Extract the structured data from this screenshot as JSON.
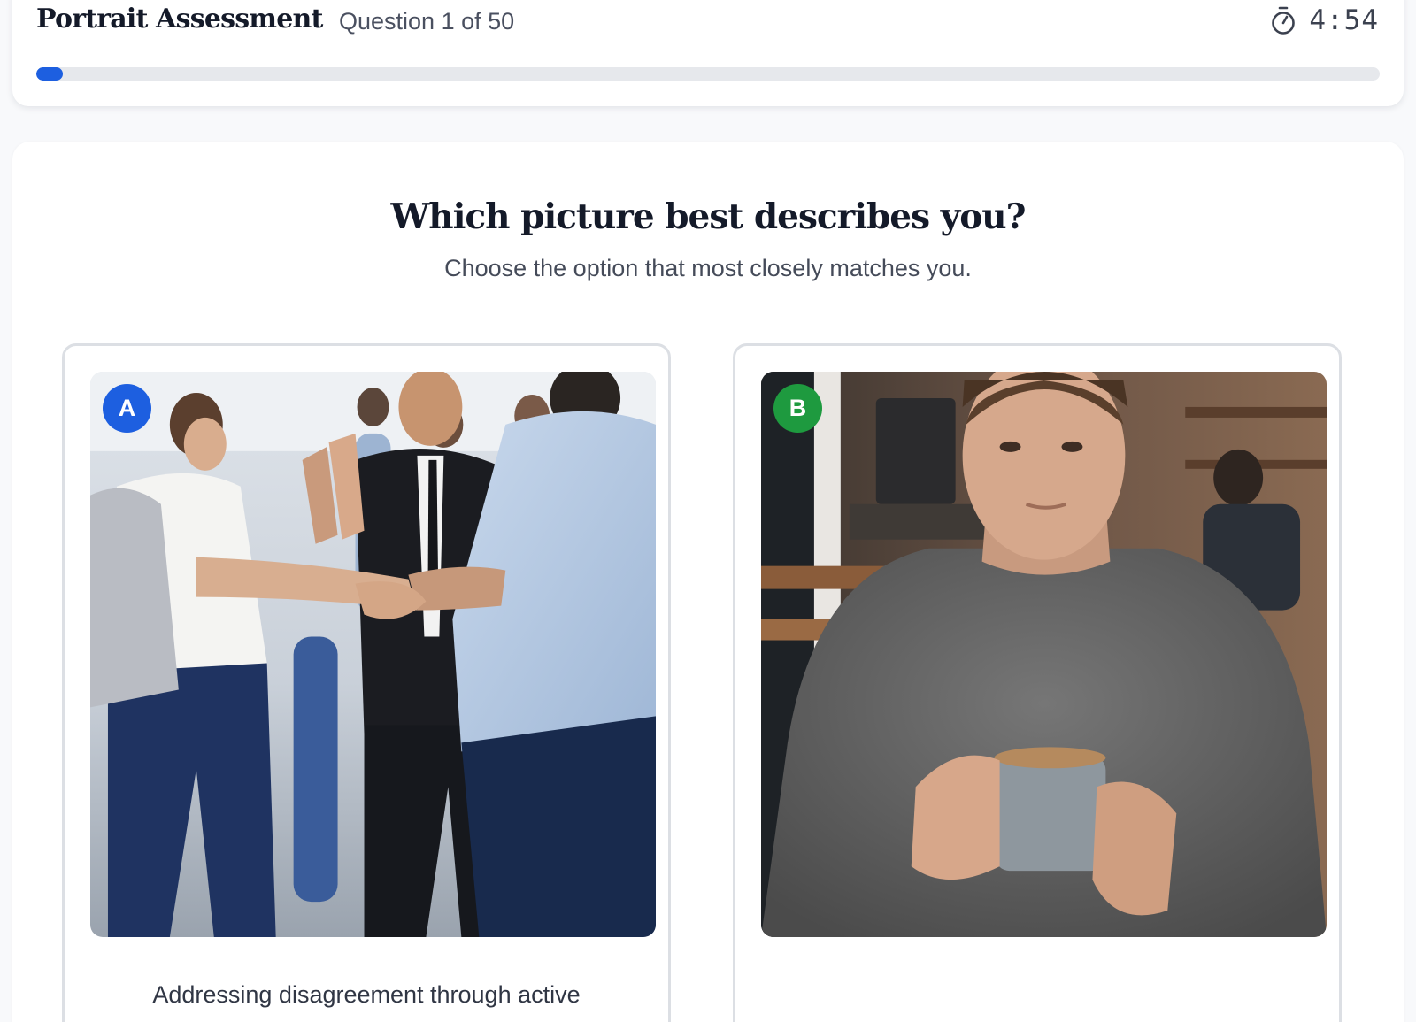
{
  "header": {
    "title": "Portrait Assessment",
    "question_counter": "Question 1 of 50",
    "timer": "4:54",
    "progress": 0.02,
    "accent_color": "#1d5fe0"
  },
  "question": {
    "title": "Which picture best describes you?",
    "subtitle": "Choose the option that most closely matches you."
  },
  "options": [
    {
      "letter": "A",
      "badge_color": "#1d5fe0",
      "caption": "Addressing disagreement through active"
    },
    {
      "letter": "B",
      "badge_color": "#1e9a3f",
      "caption": ""
    }
  ]
}
